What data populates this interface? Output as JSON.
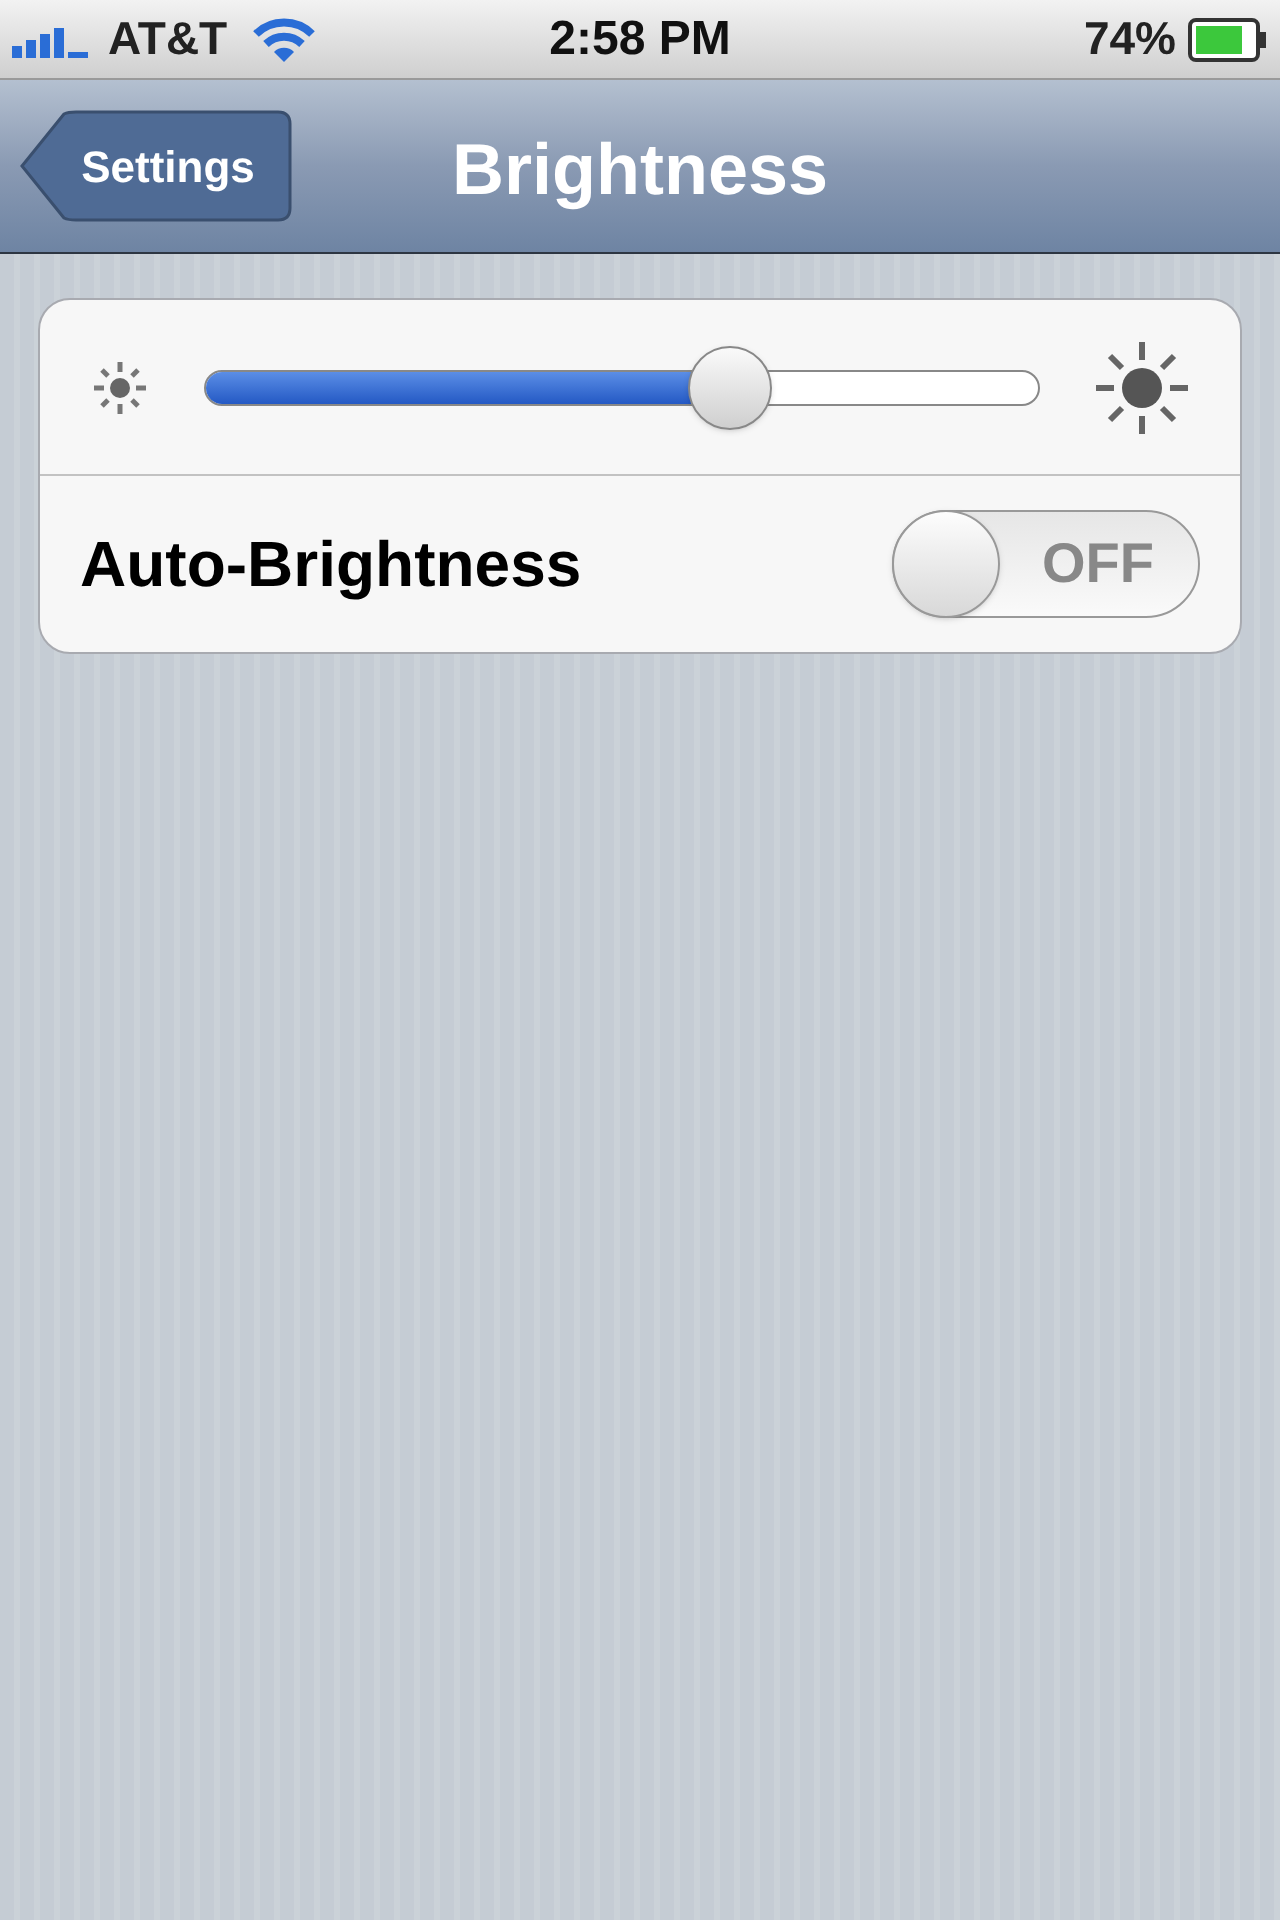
{
  "status_bar": {
    "carrier": "AT&T",
    "time": "2:58 PM",
    "battery": "74%"
  },
  "nav_bar": {
    "back_button": "Settings",
    "title": "Brightness"
  },
  "brightness_slider": {
    "level": 0.63
  },
  "auto_brightness": {
    "label": "Auto-Brightness",
    "on": false,
    "switch_text": "OFF"
  }
}
